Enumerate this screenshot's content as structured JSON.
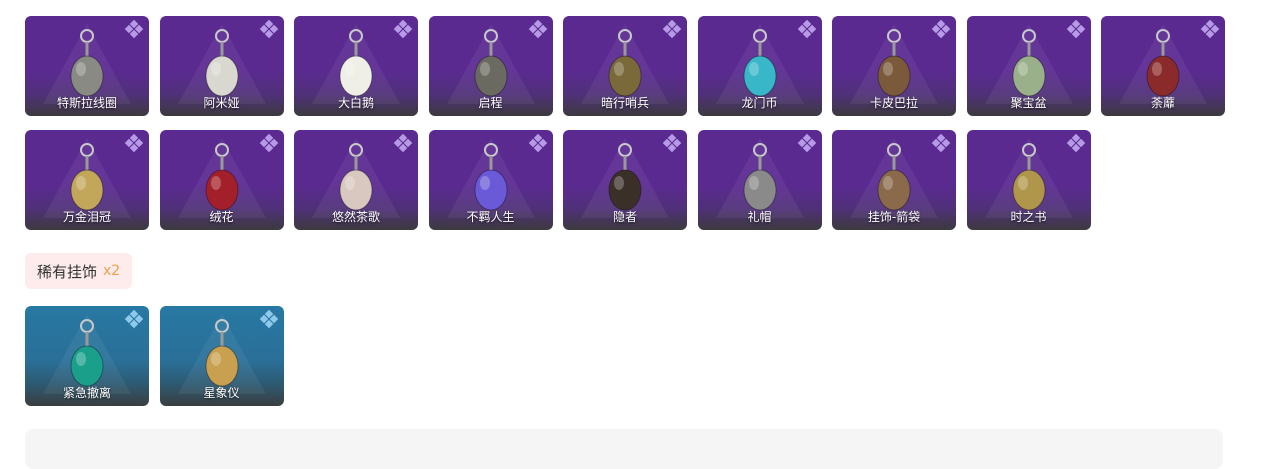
{
  "epic_items": [
    {
      "name": "特斯拉线圈",
      "icon": "tesla-coil-charm-icon",
      "color": "#8a8a84"
    },
    {
      "name": "阿米娅",
      "icon": "amiya-charm-icon",
      "color": "#d8d8d0"
    },
    {
      "name": "大白鹅",
      "icon": "white-goose-charm-icon",
      "color": "#efefe8"
    },
    {
      "name": "启程",
      "icon": "departure-charm-icon",
      "color": "#6a6a60"
    },
    {
      "name": "暗行哨兵",
      "icon": "shadow-sentinel-charm-icon",
      "color": "#7a6a3a"
    },
    {
      "name": "龙门币",
      "icon": "lungmen-coin-charm-icon",
      "color": "#37b7c8"
    },
    {
      "name": "卡皮巴拉",
      "icon": "capybara-charm-icon",
      "color": "#7a5a3a"
    },
    {
      "name": "聚宝盆",
      "icon": "treasure-bowl-charm-icon",
      "color": "#9ab08a"
    },
    {
      "name": "荼蘼",
      "icon": "tumi-flower-charm-icon",
      "color": "#8a2a2a"
    },
    {
      "name": "万金泪冠",
      "icon": "tear-crown-charm-icon",
      "color": "#c2a65a"
    },
    {
      "name": "绒花",
      "icon": "velvet-flower-charm-icon",
      "color": "#a3202a"
    },
    {
      "name": "悠然茶歌",
      "icon": "tea-song-charm-icon",
      "color": "#d8c8c0"
    },
    {
      "name": "不羁人生",
      "icon": "sneaker-charm-icon",
      "color": "#6a5ad8"
    },
    {
      "name": "隐者",
      "icon": "hermit-tarot-charm-icon",
      "color": "#3a3028"
    },
    {
      "name": "礼帽",
      "icon": "top-hat-charm-icon",
      "color": "#8a8a8a"
    },
    {
      "name": "挂饰-箭袋",
      "icon": "quiver-charm-icon",
      "color": "#8a6a4a"
    },
    {
      "name": "时之书",
      "icon": "book-of-time-charm-icon",
      "color": "#b0964a"
    }
  ],
  "rare_label": "稀有挂饰",
  "rare_count": "x2",
  "rare_items": [
    {
      "name": "紧急撤离",
      "icon": "emergency-evac-charm-icon",
      "color": "#1aa08a"
    },
    {
      "name": "星象仪",
      "icon": "astrolabe-charm-icon",
      "color": "#c8a050"
    }
  ]
}
